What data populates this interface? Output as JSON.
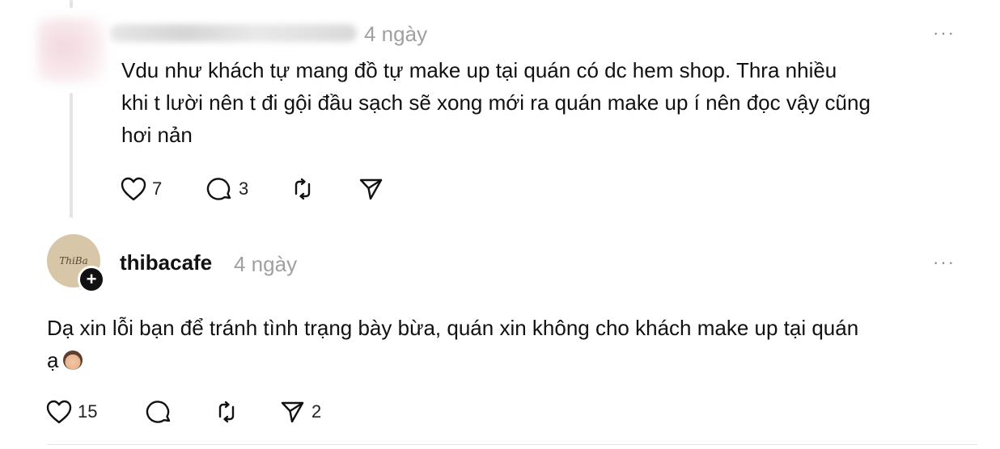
{
  "comment1": {
    "time": "4 ngày",
    "text_lines": [
      "Vdu như khách tự mang đồ tự make up tại quán có dc hem shop. Thra nhiều",
      "khi t lười nên t đi gội đầu sạch sẽ xong mới ra quán make up í nên đọc vậy cũng",
      "hơi nản"
    ],
    "likes": "7",
    "replies": "3",
    "more": "···"
  },
  "comment2": {
    "username": "thibacafe",
    "avatar_text": "ThiBa",
    "time": "4 ngày",
    "text_line1": "Dạ xin lỗi bạn để tránh tình trạng bày bừa, quán xin không cho khách make up tại quán",
    "text_line2": "ạ",
    "likes": "15",
    "shares": "2",
    "more": "···",
    "plus": "+"
  },
  "icons": [
    "heart-icon",
    "comment-icon",
    "repost-icon",
    "share-icon",
    "follow-plus-icon",
    "more-icon"
  ]
}
